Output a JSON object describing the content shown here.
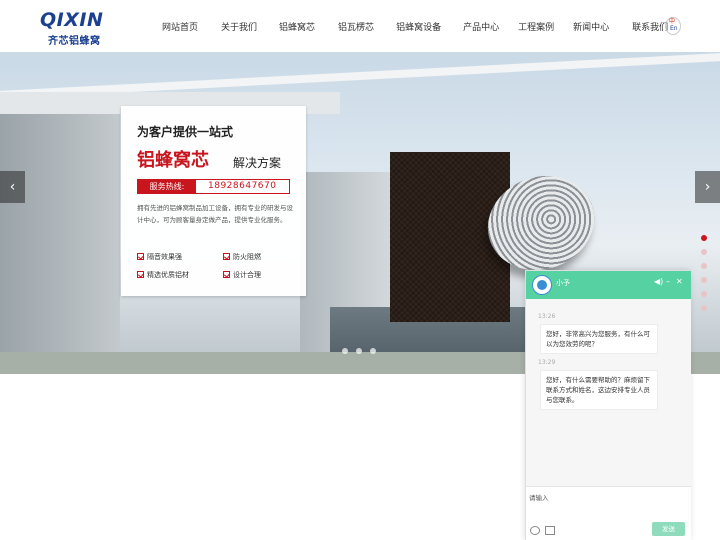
{
  "header": {
    "logo_main": "QIXIN",
    "logo_sub": "齐芯铝蜂窝",
    "nav": [
      "网站首页",
      "关于我们",
      "铝蜂窝芯",
      "铝瓦楞芯",
      "铝蜂窝设备",
      "产品中心",
      "工程案例",
      "新闻中心",
      "联系我们"
    ],
    "lang_cn": "中",
    "lang_en": "En"
  },
  "hero": {
    "line1": "为客户提供一站式",
    "line2_red": "铝蜂窝芯",
    "line2_rest": "解决方案",
    "hotline_label": "服务热线:",
    "hotline_number": "18928647670",
    "description": "拥有先进的铝蜂窝制品加工设备，拥有专业的研发与设计中心，可为顾客量身定做产品，提供专业化服务。",
    "features": [
      "隔音效果强",
      "防火阻燃",
      "精选优质铝材",
      "设计合理"
    ],
    "prev_arrow": "‹",
    "next_arrow": "›",
    "slide_count_vertical": 6,
    "slide_count_horizontal": 3
  },
  "chat": {
    "agent_name": "小予",
    "sound_icon": "◀)",
    "minimize": "–",
    "close": "✕",
    "messages": [
      {
        "time": "13:26",
        "text": "您好，非常高兴为您服务，有什么可以为您效劳的呢？"
      },
      {
        "time": "13:29",
        "text": "您好，有什么需要帮助的？麻烦留下联系方式和姓名，这边安排专业人员与您联系。"
      }
    ],
    "input_placeholder": "请输入",
    "send_label": "发送"
  },
  "colors": {
    "brand_blue": "#1b3f91",
    "accent_red": "#c9151e",
    "chat_green": "#56d1a2"
  }
}
